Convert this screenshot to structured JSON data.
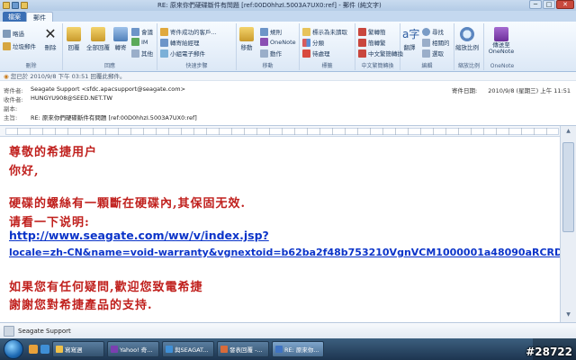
{
  "window": {
    "title": "RE: 原來你們硬碟斷件有問題 [ref:00D0hhzI.5003A7UX0:ref] - 郵件 (純文字)",
    "minimize": "─",
    "maximize": "□",
    "close": "✕"
  },
  "tabs": {
    "file": "檔案",
    "message": "郵件"
  },
  "ribbon": {
    "groups": {
      "delete": {
        "label": "刪除",
        "ignore": "略過",
        "junk": "垃圾郵件",
        "delete": "刪除"
      },
      "respond": {
        "label": "回應",
        "reply": "回覆",
        "reply_all": "全部回覆",
        "forward": "轉寄",
        "meeting": "會議",
        "im": "IM",
        "more": "其他"
      },
      "quick_steps": {
        "label": "快速步驟",
        "item1": "寄件成功的客戶...",
        "item2": "轉寄給經理",
        "item3": "小組電子郵件"
      },
      "move": {
        "label": "移動",
        "move": "移動",
        "rules": "規則",
        "onenote": "OneNote",
        "actions": "動作"
      },
      "tags": {
        "label": "標籤",
        "mark_unread": "標示為未讀取",
        "categorize": "分類",
        "follow_up": "待處理"
      },
      "chinese": {
        "label": "中文繁簡轉換",
        "to_trad": "繁轉簡",
        "to_simp": "簡轉繁",
        "conversion": "中文繁簡轉換"
      },
      "editing": {
        "label": "編輯",
        "translate": "翻譯",
        "find": "尋找",
        "related": "相關的",
        "select": "選取"
      },
      "zoom": {
        "label": "縮放比例",
        "zoom": "縮放比例"
      },
      "onenote": {
        "label": "OneNote",
        "send": "傳送至 OneNote"
      }
    }
  },
  "header": {
    "info": "您已於 2010/9/8 下午 03:51 回覆此郵件。",
    "from_label": "寄件者:",
    "from": "Seagate Support <sfdc.apacsupport@seagate.com>",
    "to_label": "收件者:",
    "to": "HUNGYU908@SEED.NET.TW",
    "cc_label": "副本:",
    "cc": "",
    "subject_label": "主旨:",
    "subject": "RE: 原來你們硬碟斷件有問題 [ref:00D0hhzI.5003A7UX0:ref]",
    "sent_label": "寄件日期:",
    "sent": "2010/9/8 (星期三) 上午 11:51"
  },
  "body": {
    "line1": "尊敬的希捷用户",
    "line2": "你好,",
    "line3": "硬碟的螺絲有一顆斷在硬碟內,其保固无效.",
    "line4": "请看一下说明:",
    "link1": "http://www.seagate.com/ww/v/index.jsp?",
    "link2": "locale=zh-CN&name=void-warranty&vgnextoid=b62ba2f48b753210VgnVCM1000001a48090aRCRD",
    "line5": "如果您有任何疑問,歡迎您致電希捷",
    "line6": "謝謝您對希捷產品的支持."
  },
  "people_pane": {
    "name": "Seagate Support"
  },
  "taskbar": {
    "items": [
      "寫寫週",
      "Yahoo! 奇...",
      "與SEAGAT...",
      "發表回覆 -...",
      "RE: 原來你..."
    ]
  },
  "watermark": "#28722",
  "colors": {
    "body_text": "#c0201d",
    "link": "#0b34c9",
    "accent": "#3a6fb5"
  }
}
